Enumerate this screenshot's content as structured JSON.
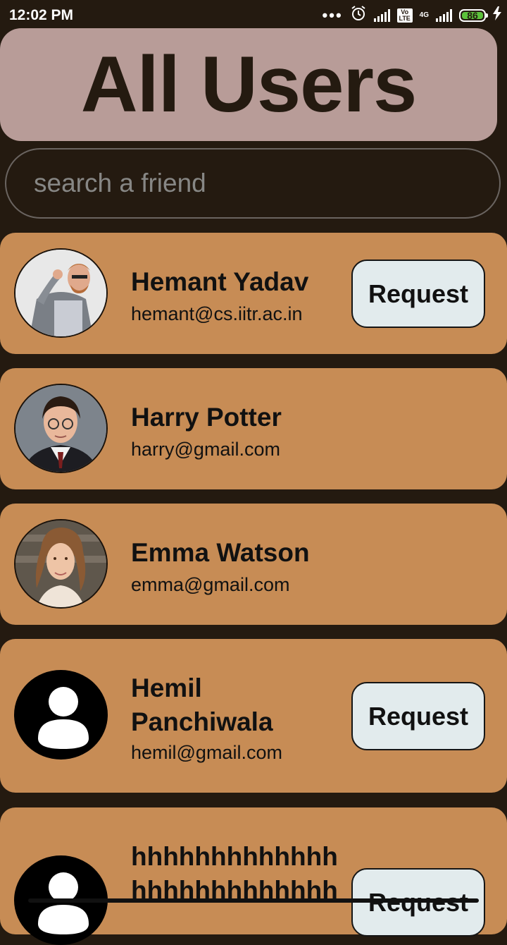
{
  "status_bar": {
    "time": "12:02 PM",
    "dots": "•••",
    "volte_label": "Vo LTE",
    "network_label": "4G",
    "battery": "86",
    "icons": [
      "alarm-icon",
      "signal-icon",
      "volte-icon",
      "charging-icon"
    ]
  },
  "header": {
    "title": "All Users"
  },
  "search": {
    "placeholder": "search a friend",
    "value": ""
  },
  "users": [
    {
      "name": "Hemant Yadav",
      "email": "hemant@cs.iitr.ac.in",
      "action": "Request",
      "avatar": "photo"
    },
    {
      "name": "Harry Potter",
      "email": "harry@gmail.com",
      "action": "",
      "avatar": "photo"
    },
    {
      "name": "Emma Watson",
      "email": "emma@gmail.com",
      "action": "",
      "avatar": "photo"
    },
    {
      "name": "Hemil Panchiwala",
      "email": "hemil@gmail.com",
      "action": "Request",
      "avatar": "default-avatar-icon"
    },
    {
      "name": "hhhhhhhhhhhhh hhhhhhhhhhhhh",
      "email": "",
      "action": "Request",
      "avatar": "default-avatar-icon"
    }
  ],
  "colors": {
    "background": "#241a10",
    "header": "#b89c98",
    "card": "#c78c55",
    "button": "#e2ebed"
  }
}
